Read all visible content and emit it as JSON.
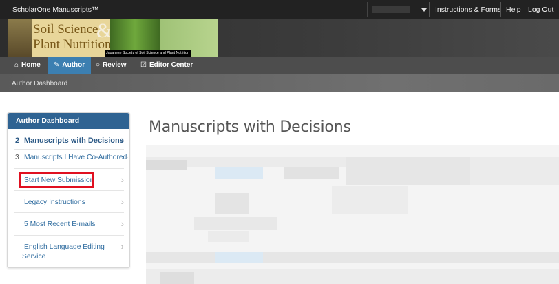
{
  "topbar": {
    "brand": "ScholarOne Manuscripts™",
    "user_placeholder": "",
    "links": [
      "Instructions & Forms",
      "Help",
      "Log Out"
    ]
  },
  "banner": {
    "logo_line1": "Soil Science",
    "logo_line2": "Plant Nutrition",
    "logo_amp": "&",
    "society": "Japanese Society of Soil Science and Plant Nutrition"
  },
  "nav": {
    "items": [
      {
        "label": "Home",
        "icon": "home-icon",
        "glyph": "⌂"
      },
      {
        "label": "Author",
        "icon": "pencil-icon",
        "glyph": "✎"
      },
      {
        "label": "Review",
        "icon": "comment-icon",
        "glyph": "○"
      },
      {
        "label": "Editor Center",
        "icon": "checkbox-icon",
        "glyph": "☑"
      }
    ],
    "active": "Author"
  },
  "subnav": {
    "breadcrumb": "Author Dashboard"
  },
  "sidebar": {
    "heading": "Author Dashboard",
    "items": [
      {
        "count": "2",
        "label": "Manuscripts with Decisions",
        "chevron": "›"
      },
      {
        "count": "3",
        "label": "Manuscripts I Have Co-Authored",
        "chevron": "›"
      },
      {
        "label": "Start New Submission",
        "chevron": "›"
      },
      {
        "label": "Legacy Instructions",
        "chevron": "›"
      },
      {
        "label": "5 Most Recent E-mails",
        "chevron": "›"
      },
      {
        "label": "English Language Editing",
        "label2": "Service",
        "chevron": "›"
      }
    ]
  },
  "main": {
    "title": "Manuscripts with Decisions"
  },
  "colors": {
    "accent": "#3c7fb1",
    "sidebar_header": "#2f6392",
    "link": "#2f6c9f",
    "highlight_border": "#e01020"
  }
}
